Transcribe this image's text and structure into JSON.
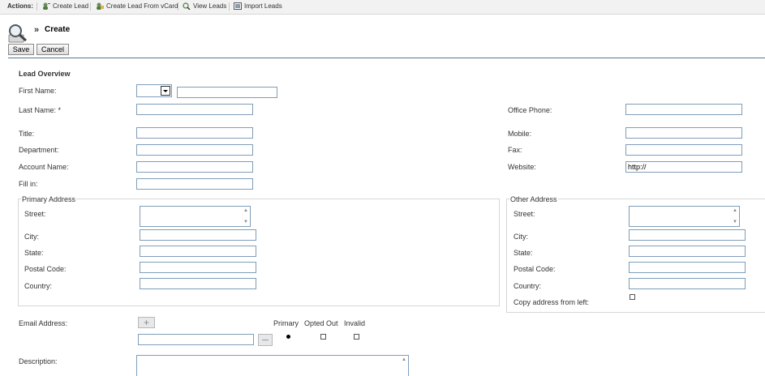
{
  "actions": {
    "label": "Actions:",
    "items": [
      {
        "label": "Create Lead",
        "icon": "create-lead-icon"
      },
      {
        "label": "Create Lead From vCard",
        "icon": "vcard-icon"
      },
      {
        "label": "View Leads",
        "icon": "view-leads-icon"
      },
      {
        "label": "Import Leads",
        "icon": "import-icon"
      }
    ]
  },
  "header": {
    "chevron": "»",
    "title": "Create",
    "icon": "magnifier-icon"
  },
  "buttons": {
    "save": "Save",
    "cancel": "Cancel"
  },
  "section": {
    "title": "Lead Overview"
  },
  "fields": {
    "first_name": "First Name:",
    "last_name": "Last Name: *",
    "title": "Title:",
    "department": "Department:",
    "account_name": "Account Name:",
    "fill_in": "Fill in:",
    "office_phone": "Office Phone:",
    "mobile": "Mobile:",
    "fax": "Fax:",
    "website": "Website:",
    "website_value": "http://"
  },
  "primary_address": {
    "legend": "Primary Address",
    "street": "Street:",
    "city": "City:",
    "state": "State:",
    "postal_code": "Postal Code:",
    "country": "Country:"
  },
  "other_address": {
    "legend": "Other Address",
    "street": "Street:",
    "city": "City:",
    "state": "State:",
    "postal_code": "Postal Code:",
    "country": "Country:",
    "copy": "Copy address from left:"
  },
  "email": {
    "label": "Email Address:",
    "add": "+",
    "remove": "—",
    "primary": "Primary",
    "opted_out": "Opted Out",
    "invalid": "Invalid"
  },
  "description": {
    "label": "Description:"
  }
}
